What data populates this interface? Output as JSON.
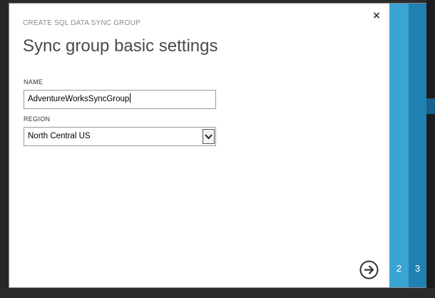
{
  "dialog": {
    "subtitle": "CREATE SQL DATA SYNC GROUP",
    "title": "Sync group basic settings",
    "close_symbol": "×"
  },
  "form": {
    "name_label": "NAME",
    "name_value": "AdventureWorksSyncGroup",
    "region_label": "REGION",
    "region_value": "North Central US"
  },
  "steps": [
    {
      "number": "2"
    },
    {
      "number": "3"
    }
  ],
  "icons": {
    "close": "close-icon",
    "next": "arrow-right-circle-icon",
    "dropdown": "chevron-down-icon"
  },
  "colors": {
    "step_2_bg": "#3aa5d3",
    "step_3_bg": "#1f80b2",
    "title_text": "#4a4a4a",
    "subtitle_text": "#8a8a8a"
  }
}
